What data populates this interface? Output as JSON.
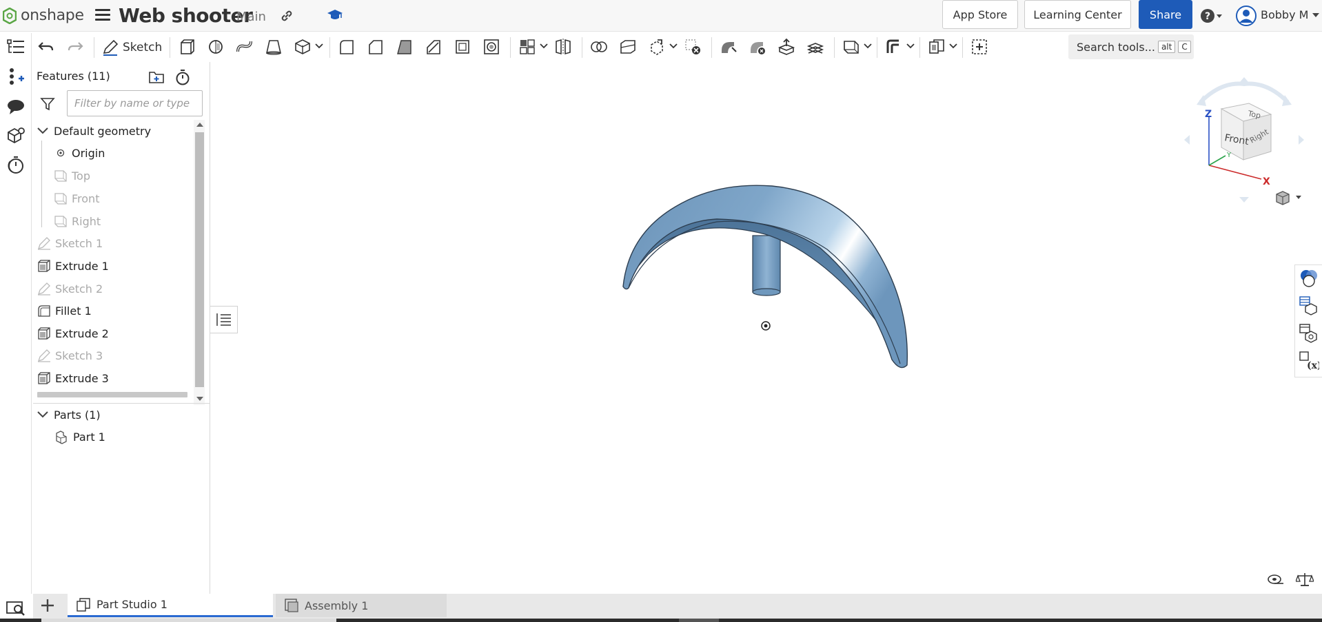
{
  "app": {
    "logo_text": "onshape",
    "doc_title": "Web shooter",
    "workspace": "Main"
  },
  "header": {
    "app_store": "App Store",
    "learning_center": "Learning Center",
    "share": "Share",
    "user_name": "Bobby M"
  },
  "toolbar": {
    "sketch_label": "Sketch",
    "search_label": "Search tools...",
    "search_key1": "alt",
    "search_key2": "C"
  },
  "features": {
    "title": "Features (11)",
    "filter_placeholder": "Filter by name or type",
    "default_geometry": "Default geometry",
    "items": [
      {
        "label": "Origin"
      },
      {
        "label": "Top"
      },
      {
        "label": "Front"
      },
      {
        "label": "Right"
      },
      {
        "label": "Sketch 1"
      },
      {
        "label": "Extrude 1"
      },
      {
        "label": "Sketch 2"
      },
      {
        "label": "Fillet 1"
      },
      {
        "label": "Extrude 2"
      },
      {
        "label": "Sketch 3"
      },
      {
        "label": "Extrude 3"
      }
    ],
    "parts_title": "Parts (1)",
    "parts": [
      {
        "label": "Part 1"
      }
    ]
  },
  "navcube": {
    "top": "Top",
    "front": "Front",
    "right": "Right",
    "axis_x": "X",
    "axis_y": "Y",
    "axis_z": "Z"
  },
  "tabs": [
    {
      "label": "Part Studio 1"
    },
    {
      "label": "Assembly 1"
    }
  ],
  "colors": {
    "accent": "#1e5bb8",
    "model_fill": "#7fa6c9",
    "tab_underline": "#2a6ad1"
  }
}
